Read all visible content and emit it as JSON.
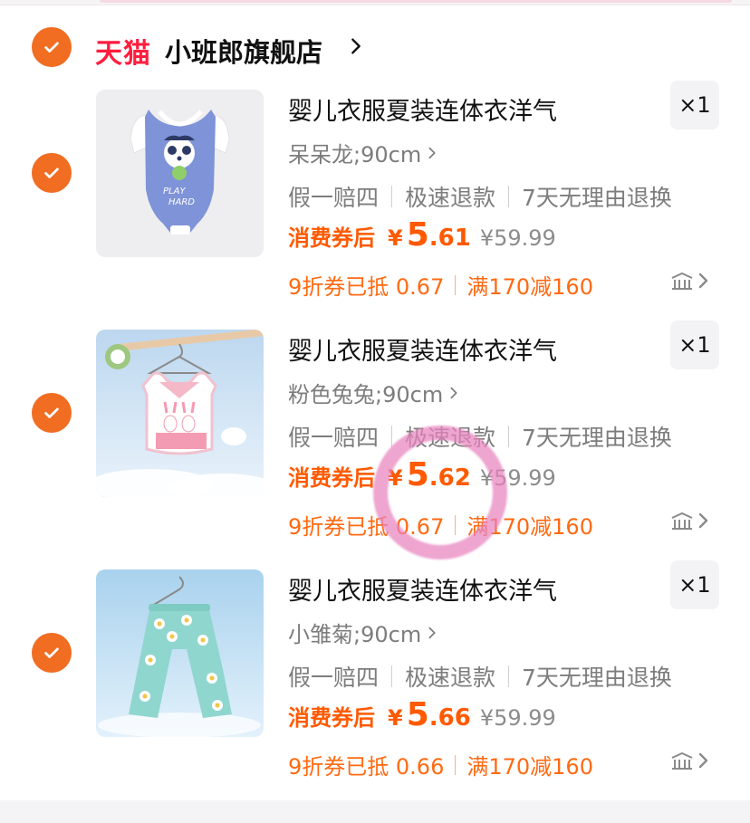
{
  "store": {
    "badge": "天猫",
    "name": "小班郎旗舰店"
  },
  "items": [
    {
      "title": "婴儿衣服夏装连体衣洋气",
      "qty": "×1",
      "sku": "呆呆龙;90cm",
      "services": [
        "假一赔四",
        "极速退款",
        "7天无理由退换"
      ],
      "price_label": "消费券后",
      "currency": "¥",
      "price_int": "5",
      "price_dec": ".61",
      "original_price": "¥59.99",
      "coupons": [
        "9折券已抵 0.67",
        "满170减160"
      ],
      "image": "blue-onesie-with-panda-print",
      "checked": true
    },
    {
      "title": "婴儿衣服夏装连体衣洋气",
      "qty": "×1",
      "sku": "粉色兔兔;90cm",
      "services": [
        "假一赔四",
        "极速退款",
        "7天无理由退换"
      ],
      "price_label": "消费券后",
      "currency": "¥",
      "price_int": "5",
      "price_dec": ".62",
      "original_price": "¥59.99",
      "coupons": [
        "9折券已抵 0.67",
        "满170减160"
      ],
      "image": "pink-bunny-vest-on-hanger",
      "checked": true
    },
    {
      "title": "婴儿衣服夏装连体衣洋气",
      "qty": "×1",
      "sku": "小雏菊;90cm",
      "services": [
        "假一赔四",
        "极速退款",
        "7天无理由退换"
      ],
      "price_label": "消费券后",
      "currency": "¥",
      "price_int": "5",
      "price_dec": ".66",
      "original_price": "¥59.99",
      "coupons": [
        "9折券已抵 0.66",
        "满170减160"
      ],
      "image": "daisy-print-pants-on-hanger",
      "checked": true
    }
  ],
  "colors": {
    "accent": "#f06d22",
    "price": "#ff5a00",
    "tmall_red": "#ff1d3e",
    "annotation": "#e882be"
  }
}
